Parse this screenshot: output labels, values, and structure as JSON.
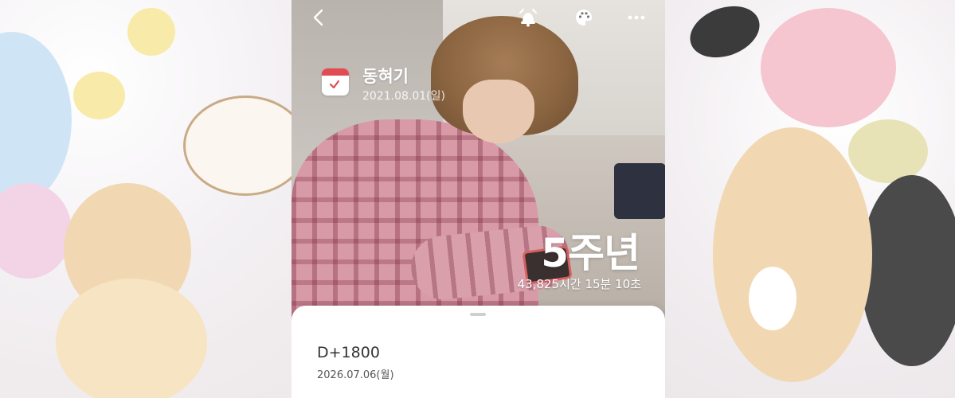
{
  "header": {
    "back_icon": "chevron-left-icon",
    "alarm_icon": "alarm-bell-icon",
    "palette_icon": "palette-icon",
    "more_icon": "more-horizontal-icon"
  },
  "dday": {
    "title": "동혀기",
    "start_date": "2021.08.01(일)",
    "icon": "calendar-check-icon",
    "icon_color": "#e24b52"
  },
  "anniversary": {
    "label": "5주년",
    "elapsed": "43,825시간 15분 10초"
  },
  "sheet": {
    "count": "D+1800",
    "date": "2026.07.06(월)"
  }
}
